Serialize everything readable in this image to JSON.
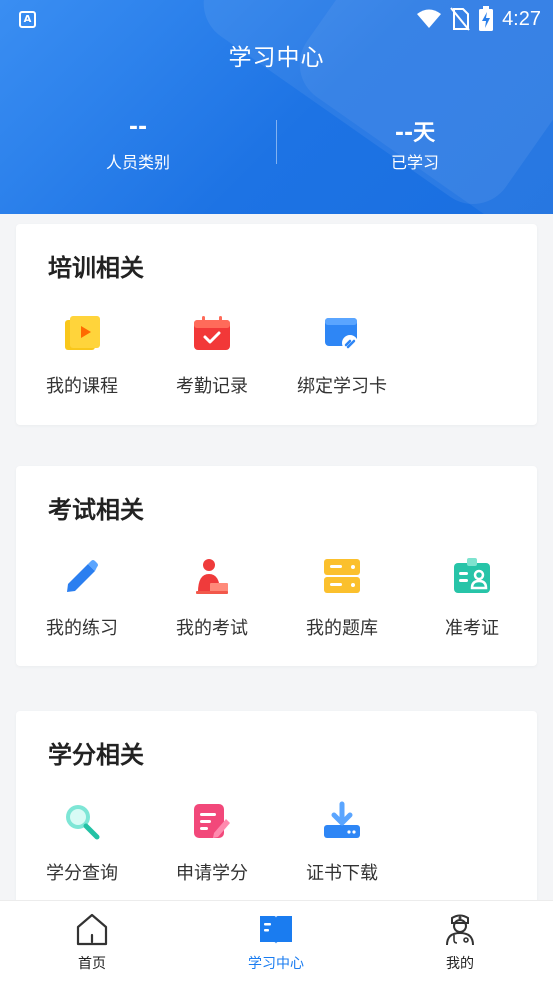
{
  "status_bar": {
    "time": "4:27",
    "app_icon_letter": "A"
  },
  "header": {
    "title": "学习中心",
    "stats": [
      {
        "value": "--",
        "label": "人员类别"
      },
      {
        "value": "--天",
        "label": "已学习"
      }
    ]
  },
  "sections": [
    {
      "title": "培训相关",
      "items": [
        {
          "label": "我的课程",
          "icon": "video-play-icon"
        },
        {
          "label": "考勤记录",
          "icon": "calendar-check-icon"
        },
        {
          "label": "绑定学习卡",
          "icon": "card-link-icon"
        }
      ]
    },
    {
      "title": "考试相关",
      "items": [
        {
          "label": "我的练习",
          "icon": "pencil-icon"
        },
        {
          "label": "我的考试",
          "icon": "exam-person-icon"
        },
        {
          "label": "我的题库",
          "icon": "question-bank-icon"
        },
        {
          "label": "准考证",
          "icon": "admission-ticket-icon"
        }
      ]
    },
    {
      "title": "学分相关",
      "items": [
        {
          "label": "学分查询",
          "icon": "search-icon"
        },
        {
          "label": "申请学分",
          "icon": "apply-form-icon"
        },
        {
          "label": "证书下载",
          "icon": "download-icon"
        }
      ]
    }
  ],
  "tabbar": {
    "tabs": [
      {
        "label": "首页",
        "icon": "home-icon",
        "active": false
      },
      {
        "label": "学习中心",
        "icon": "book-icon",
        "active": true
      },
      {
        "label": "我的",
        "icon": "doctor-icon",
        "active": false
      }
    ],
    "active_color": "#1a7cf0"
  },
  "colors": {
    "header_blue": "#1d73e4",
    "background": "#f4f5f7"
  }
}
